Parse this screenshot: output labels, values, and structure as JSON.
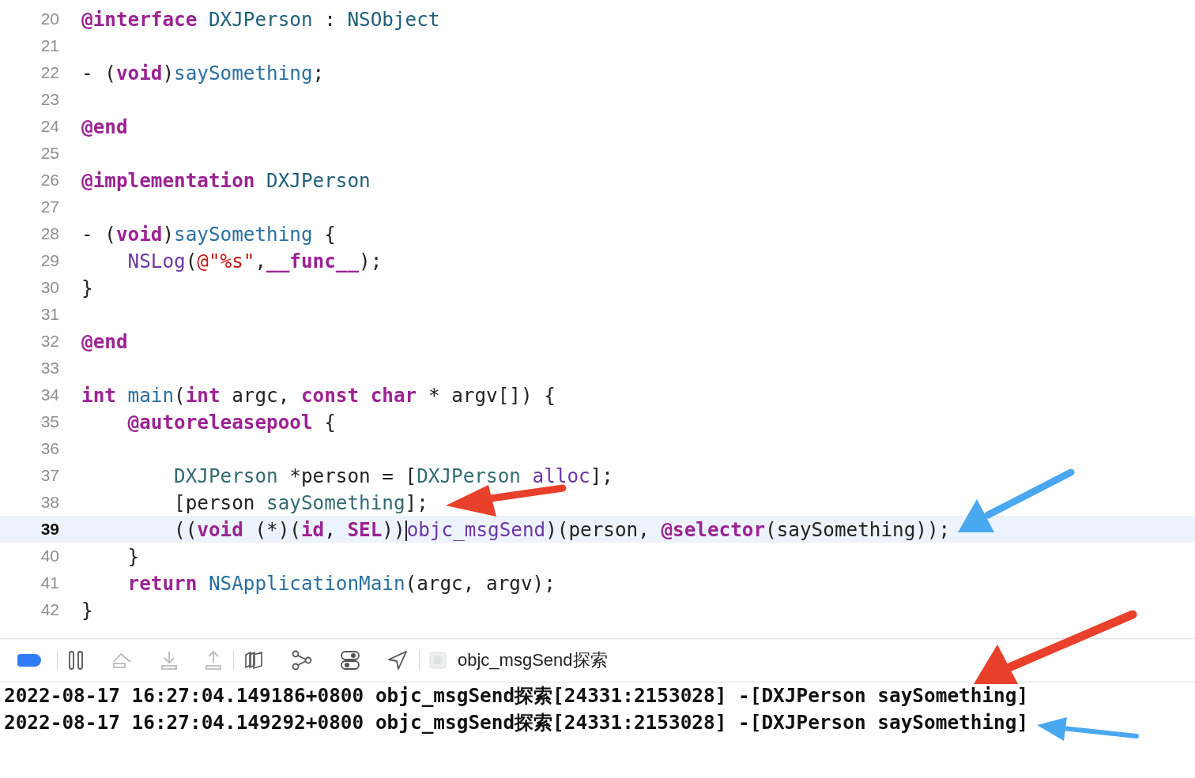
{
  "editor": {
    "lines": [
      {
        "number": "20",
        "current": false,
        "tokens": [
          {
            "text": "@interface ",
            "kind": "keyword"
          },
          {
            "text": "DXJPerson",
            "kind": "class"
          },
          {
            "text": " : ",
            "kind": "plain"
          },
          {
            "text": "NSObject",
            "kind": "class"
          }
        ]
      },
      {
        "number": "21",
        "current": false
      },
      {
        "number": "22",
        "current": false,
        "tokens": [
          {
            "text": "- (",
            "kind": "plain"
          },
          {
            "text": "void",
            "kind": "keyword"
          },
          {
            "text": ")",
            "kind": "plain"
          },
          {
            "text": "saySomething",
            "kind": "decl"
          },
          {
            "text": ";",
            "kind": "plain"
          }
        ]
      },
      {
        "number": "23",
        "current": false
      },
      {
        "number": "24",
        "current": false,
        "tokens": [
          {
            "text": "@end",
            "kind": "keyword"
          }
        ]
      },
      {
        "number": "25",
        "current": false
      },
      {
        "number": "26",
        "current": false,
        "tokens": [
          {
            "text": "@implementation ",
            "kind": "keyword"
          },
          {
            "text": "DXJPerson",
            "kind": "class"
          }
        ]
      },
      {
        "number": "27",
        "current": false
      },
      {
        "number": "28",
        "current": false,
        "tokens": [
          {
            "text": "- (",
            "kind": "plain"
          },
          {
            "text": "void",
            "kind": "keyword"
          },
          {
            "text": ")",
            "kind": "plain"
          },
          {
            "text": "saySomething",
            "kind": "decl"
          },
          {
            "text": " {",
            "kind": "plain"
          }
        ]
      },
      {
        "number": "29",
        "current": false,
        "tokens": [
          {
            "text": "    NSLog",
            "kind": "function"
          },
          {
            "text": "(",
            "kind": "plain"
          },
          {
            "text": "@\"%s\"",
            "kind": "string"
          },
          {
            "text": ",",
            "kind": "plain"
          },
          {
            "text": "__func__",
            "kind": "keyword"
          },
          {
            "text": ");",
            "kind": "plain"
          }
        ]
      },
      {
        "number": "30",
        "current": false,
        "tokens": [
          {
            "text": "}",
            "kind": "plain"
          }
        ]
      },
      {
        "number": "31",
        "current": false
      },
      {
        "number": "32",
        "current": false,
        "tokens": [
          {
            "text": "@end",
            "kind": "keyword"
          }
        ]
      },
      {
        "number": "33",
        "current": false
      },
      {
        "number": "34",
        "current": false,
        "tokens": [
          {
            "text": "int ",
            "kind": "keyword"
          },
          {
            "text": "main",
            "kind": "decl"
          },
          {
            "text": "(",
            "kind": "plain"
          },
          {
            "text": "int",
            "kind": "keyword"
          },
          {
            "text": " argc, ",
            "kind": "plain"
          },
          {
            "text": "const char",
            "kind": "keyword"
          },
          {
            "text": " * argv[]) {",
            "kind": "plain"
          }
        ]
      },
      {
        "number": "35",
        "current": false,
        "tokens": [
          {
            "text": "    @autoreleasepool",
            "kind": "keyword"
          },
          {
            "text": " {",
            "kind": "plain"
          }
        ]
      },
      {
        "number": "36",
        "current": false
      },
      {
        "number": "37",
        "current": false,
        "tokens": [
          {
            "text": "        DXJPerson",
            "kind": "project"
          },
          {
            "text": " *person = [",
            "kind": "plain"
          },
          {
            "text": "DXJPerson ",
            "kind": "project"
          },
          {
            "text": "alloc",
            "kind": "function"
          },
          {
            "text": "];",
            "kind": "plain"
          }
        ]
      },
      {
        "number": "38",
        "current": false,
        "tokens": [
          {
            "text": "        [person ",
            "kind": "plain"
          },
          {
            "text": "saySomething",
            "kind": "project"
          },
          {
            "text": "];",
            "kind": "plain"
          }
        ]
      },
      {
        "number": "39",
        "current": true,
        "tokens": [
          {
            "text": "        ((",
            "kind": "plain"
          },
          {
            "text": "void",
            "kind": "keyword"
          },
          {
            "text": " (*)(",
            "kind": "plain"
          },
          {
            "text": "id",
            "kind": "keyword"
          },
          {
            "text": ", ",
            "kind": "plain"
          },
          {
            "text": "SEL",
            "kind": "keyword"
          },
          {
            "text": "))",
            "kind": "plain"
          },
          {
            "kind": "cursor"
          },
          {
            "text": "objc_msgSend",
            "kind": "function"
          },
          {
            "text": ")(person, ",
            "kind": "plain"
          },
          {
            "text": "@selector",
            "kind": "keyword"
          },
          {
            "text": "(saySomething));",
            "kind": "plain"
          }
        ]
      },
      {
        "number": "40",
        "current": false,
        "tokens": [
          {
            "text": "    }",
            "kind": "plain"
          }
        ]
      },
      {
        "number": "41",
        "current": false,
        "tokens": [
          {
            "text": "    return ",
            "kind": "keyword"
          },
          {
            "text": "NSApplicationMain",
            "kind": "decl"
          },
          {
            "text": "(argc, argv);",
            "kind": "plain"
          }
        ]
      },
      {
        "number": "42",
        "current": false,
        "tokens": [
          {
            "text": "}",
            "kind": "plain"
          }
        ]
      }
    ]
  },
  "debug_bar": {
    "breakpoints_active": true,
    "target": "objc_msgSend探索"
  },
  "console": {
    "lines": [
      "2022-08-17 16:27:04.149186+0800 objc_msgSend探索[24331:2153028] -[DXJPerson saySomething]",
      "2022-08-17 16:27:04.149292+0800 objc_msgSend探索[24331:2153028] -[DXJPerson saySomething]"
    ]
  }
}
